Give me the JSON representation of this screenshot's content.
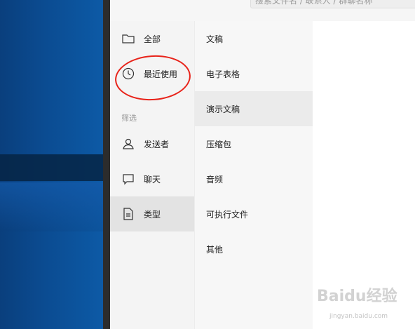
{
  "search": {
    "placeholder": "搜索文件名 / 联系人 / 群聊名称"
  },
  "nav": {
    "all": "全部",
    "recent": "最近使用",
    "section": "筛选",
    "sender": "发送者",
    "chat": "聊天",
    "type": "类型"
  },
  "categories": [
    "文稿",
    "电子表格",
    "演示文稿",
    "压缩包",
    "音频",
    "可执行文件",
    "其他"
  ],
  "watermark": {
    "brand": "Baidu经验",
    "url": "jingyan.baidu.com"
  },
  "colors": {
    "accent_annotation": "#e8231a",
    "selected_bg": "#e3e3e3"
  }
}
